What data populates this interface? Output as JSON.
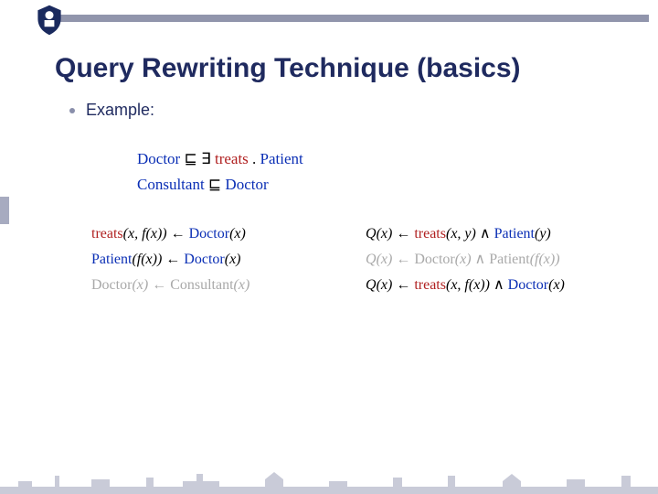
{
  "title": "Query Rewriting Technique (basics)",
  "bullet": "Example:",
  "axioms": {
    "a1": {
      "lhs": "Doctor",
      "op": "⊑",
      "exists": "∃",
      "role": "treats",
      "dot": ". ",
      "rhs": "Patient"
    },
    "a2": {
      "lhs": "Consultant",
      "op": "⊑",
      "rhs": "Doctor"
    }
  },
  "left": [
    {
      "head": "treats",
      "args": "(x, f(x))",
      "arrow": " ← ",
      "body": "Doctor",
      "bargs": "(x)",
      "muted": false
    },
    {
      "head": "Patient",
      "args": "(f(x))",
      "arrow": " ← ",
      "body": "Doctor",
      "bargs": "(x)",
      "muted": false
    },
    {
      "head": "Doctor",
      "args": "(x)",
      "arrow": " ← ",
      "body": "Consultant",
      "bargs": "(x)",
      "muted": true
    }
  ],
  "right": [
    {
      "q": "Q",
      "qargs": "(x)",
      "arrow": " ← ",
      "p1": "treats",
      "a1": "(x, y)",
      "and": " ∧ ",
      "p2": "Patient",
      "a2": "(y)",
      "muted": false
    },
    {
      "q": "Q",
      "qargs": "(x)",
      "arrow": " ← ",
      "p1": "Doctor",
      "a1": "(x)",
      "and": " ∧ ",
      "p2": "Patient",
      "a2": "(f(x))",
      "muted": true
    },
    {
      "q": "Q",
      "qargs": "(x)",
      "arrow": " ← ",
      "p1": "treats",
      "a1": "(x, f(x))",
      "and": " ∧ ",
      "p2": "Doctor",
      "a2": "(x)",
      "muted": false
    }
  ]
}
